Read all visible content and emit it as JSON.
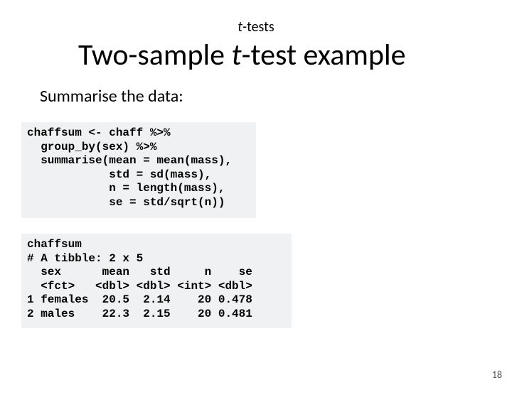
{
  "header": {
    "super_prefix": "t",
    "super_suffix": "-tests",
    "title_pre": "Two-sample ",
    "title_ital": "t",
    "title_post": "-test example"
  },
  "subheading": "Summarise the data:",
  "code": {
    "block1": "chaffsum <- chaff %>%\n  group_by(sex) %>%\n  summarise(mean = mean(mass),\n            std = sd(mass),\n            n = length(mass),\n            se = std/sqrt(n))",
    "block2": "chaffsum\n# A tibble: 2 x 5\n  sex      mean   std     n    se\n  <fct>   <dbl> <dbl> <int> <dbl>\n1 females  20.5  2.14    20 0.478\n2 males    22.3  2.15    20 0.481"
  },
  "page_number": "18"
}
